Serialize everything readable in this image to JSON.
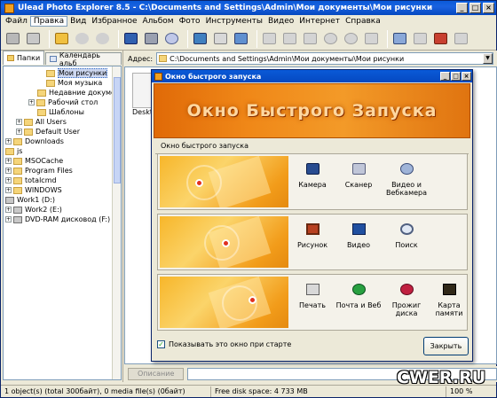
{
  "window": {
    "title": "Ulead Photo Explorer 8.5 - C:\\Documents and Settings\\Admin\\Мои документы\\Мои рисунки"
  },
  "menu": [
    "Файл",
    "Правка",
    "Вид",
    "Избранное",
    "Альбом",
    "Фото",
    "Инструменты",
    "Видео",
    "Интернет",
    "Справка"
  ],
  "menu_active_index": 1,
  "left_panel": {
    "tabs": [
      "Папки",
      "Календарь альб"
    ],
    "tree": [
      {
        "label": "Мои рисунки",
        "sel": true
      },
      {
        "label": "Моя музыка"
      },
      {
        "label": "Недавние документы"
      },
      {
        "label": "Рабочий стол"
      },
      {
        "label": "Шаблоны"
      },
      {
        "label": "All Users"
      },
      {
        "label": "Default User"
      },
      {
        "label": "Downloads"
      },
      {
        "label": "js"
      },
      {
        "label": "MSOCache"
      },
      {
        "label": "Program Files"
      },
      {
        "label": "totalcmd"
      },
      {
        "label": "WINDOWS"
      },
      {
        "label": "Work1 (D:)"
      },
      {
        "label": "Work2 (E:)"
      },
      {
        "label": "DVD-RAM дисковод (F:)"
      }
    ]
  },
  "address": {
    "label": "Адрес:",
    "value": "C:\\Documents and Settings\\Admin\\Мои документы\\Мои рисунки"
  },
  "content": {
    "thumb_label": "Deskt"
  },
  "description": {
    "button": "Описание"
  },
  "status": {
    "objects": "1 object(s) (total 300байт), 0 media file(s) (0байт)",
    "free_space": "Free disk space: 4 733 MB",
    "zoom": "100 %"
  },
  "dialog": {
    "title": "Окно быстрого запуска",
    "banner": "Окно Быстрого Запуска",
    "subtitle": "Окно быстрого запуска",
    "groups": [
      {
        "actions": [
          {
            "label": "Камера",
            "icon": "camera-icon"
          },
          {
            "label": "Сканер",
            "icon": "scanner-icon"
          },
          {
            "label": "Видео и Вебкамера",
            "icon": "webcam-icon"
          }
        ]
      },
      {
        "actions": [
          {
            "label": "Рисунок",
            "icon": "picture-icon"
          },
          {
            "label": "Видео",
            "icon": "video-icon"
          },
          {
            "label": "Поиск",
            "icon": "search-icon"
          }
        ]
      },
      {
        "actions": [
          {
            "label": "Печать",
            "icon": "printer-icon"
          },
          {
            "label": "Почта и Веб",
            "icon": "globe-icon"
          },
          {
            "label": "Прожиг диска",
            "icon": "disc-burn-icon"
          },
          {
            "label": "Карта памяти",
            "icon": "memory-card-icon"
          }
        ]
      }
    ],
    "show_on_start": "Показывать это окно при старте",
    "show_on_start_checked": true,
    "close_button": "Закрыть"
  },
  "watermark": "CWER.RU"
}
